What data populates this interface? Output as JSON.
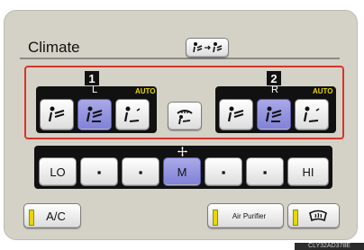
{
  "header": {
    "title": "Climate"
  },
  "zones": {
    "one": {
      "number": "1",
      "label": "L",
      "auto": "AUTO"
    },
    "two": {
      "number": "2",
      "label": "R",
      "auto": "AUTO"
    }
  },
  "fan": {
    "speeds": [
      "LO",
      "▪",
      "▪",
      "M",
      "▪",
      "▪",
      "HI"
    ],
    "selected_index": 3
  },
  "bottom": {
    "ac_label": "A/C",
    "air_purifier_label": "Air Purifier"
  },
  "watermark": "CLY32AD378E",
  "colors": {
    "selected": "#8080d8",
    "highlight_frame": "#d9332b",
    "indicator": "#e8d800"
  }
}
